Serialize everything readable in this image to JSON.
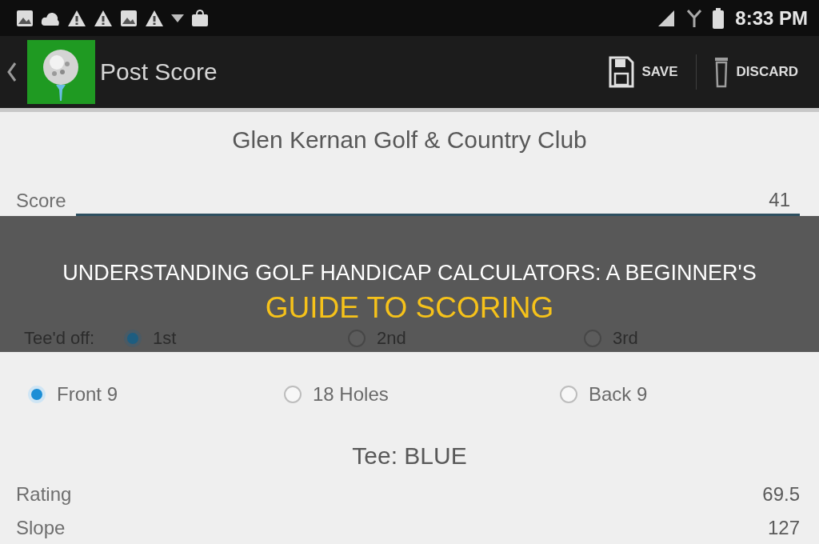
{
  "status_bar": {
    "time": "8:33 PM"
  },
  "action_bar": {
    "title": "Post Score",
    "actions": [
      {
        "label": "SAVE",
        "kind": "save"
      },
      {
        "label": "DISCARD",
        "kind": "discard"
      }
    ]
  },
  "course": "Glen Kernan Golf & Country Club",
  "score_field": {
    "label": "Score",
    "value": "41"
  },
  "banner": {
    "headline": "UNDERSTANDING GOLF HANDICAP CALCULATORS: A BEGINNER'S",
    "highlight": "GUIDE TO SCORING"
  },
  "start_hole": {
    "label": "Tee'd off:",
    "options": [
      {
        "label": "1st",
        "selected": true
      },
      {
        "label": "2nd",
        "selected": false
      },
      {
        "label": "3rd",
        "selected": false
      }
    ]
  },
  "holes": {
    "options": [
      {
        "label": "Front 9",
        "selected": true
      },
      {
        "label": "18 Holes",
        "selected": false
      },
      {
        "label": "Back 9",
        "selected": false
      }
    ]
  },
  "tee": "Tee: BLUE",
  "stats": [
    {
      "label": "Rating",
      "value": "69.5"
    },
    {
      "label": "Slope",
      "value": "127"
    }
  ]
}
